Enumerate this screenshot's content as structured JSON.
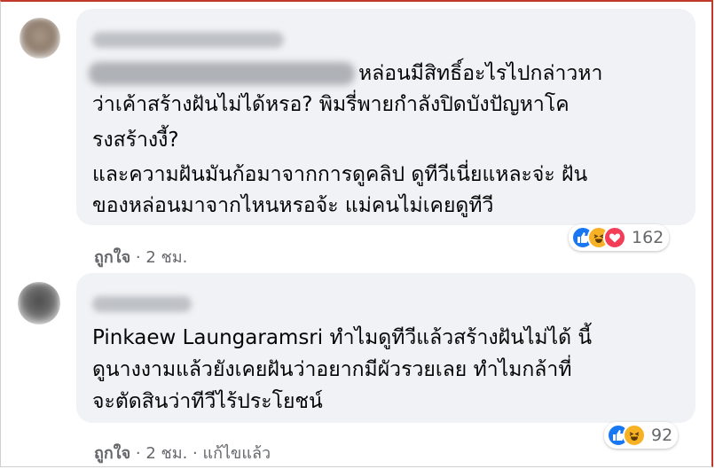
{
  "comments": [
    {
      "text_line1": "หล่อนมีสิทธิ์อะไรไปกล่าวหา",
      "text_lines": [
        "ว่าเค้าสร้างฝันไม่ได้หรอ? พิมรี่พายกำลังปิดบังปัญหาโค",
        "รงสร้างงี้?",
        "และความฝันมันก้อมาจากการดูคลิป ดูทีวีเนี่ยแหละจ่ะ ฝัน",
        "ของหล่อนมาจากไหนหรอจ้ะ แม่คนไม่เคยดูทีวี"
      ],
      "like_label": "ถูกใจ",
      "time": "2 ชม.",
      "reaction_icons": [
        "like-icon",
        "haha-icon",
        "love-icon"
      ],
      "reaction_count": "162"
    },
    {
      "text_lines": [
        "Pinkaew Laungaramsri ทำไมดูทีวีแล้วสร้างฝันไม่ได้ นี้",
        "ดูนางงามแล้วยังเคยฝันว่าอยากมีผัวรวยเลย ทำไมกล้าที่",
        "จะตัดสินว่าทีวีไร้ประโยชน์"
      ],
      "like_label": "ถูกใจ",
      "time": "2 ชม.",
      "edited": "แก้ไขแล้ว",
      "reaction_icons": [
        "like-icon",
        "haha-icon"
      ],
      "reaction_count": "92"
    }
  ],
  "separator": "·",
  "colors": {
    "bubble": "#f0f2f5",
    "meta": "#65676b",
    "like": "#1877f2",
    "haha": "#f7b125",
    "love": "#f33e58"
  }
}
